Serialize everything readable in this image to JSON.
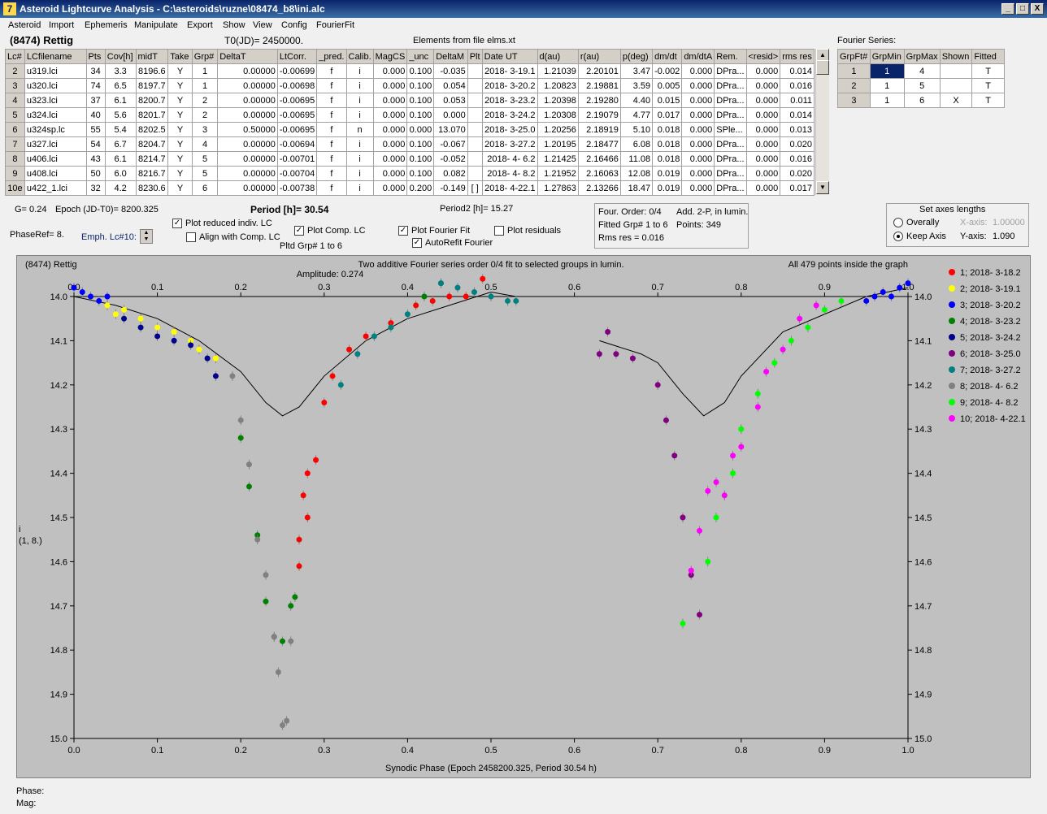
{
  "window": {
    "title": "Asteroid Lightcurve Analysis - C:\\asteroids\\ruzne\\08474_b8\\ini.alc",
    "icon": "app-icon",
    "btn_min": "_",
    "btn_max": "□",
    "btn_close": "X"
  },
  "menu": [
    "Asteroid",
    "Import",
    "Ephemeris",
    "Manipulate",
    "Export",
    "Show",
    "View",
    "Config",
    "FourierFit"
  ],
  "header": {
    "asteroid": "(8474) Rettig",
    "t0": "T0(JD)= 2450000.",
    "elements": "Elements from file elms.xt"
  },
  "table": {
    "columns": [
      "Lc#",
      "LCfilename",
      "Pts",
      "Cov[h]",
      "midT",
      "Take",
      "Grp#",
      "DeltaT",
      "LtCorr.",
      "_pred.",
      "Calib.",
      "MagCS",
      "_unc",
      "DeltaM",
      "Plt",
      "Date UT",
      "d(au)",
      "r(au)",
      "p(deg)",
      "dm/dt",
      "dm/dtA",
      "Rem.",
      "<resid>",
      "rms res"
    ],
    "rows": [
      [
        "2",
        "u319.lci",
        "34",
        "3.3",
        "8196.6",
        "Y",
        "1",
        "0.00000",
        "-0.00699",
        "f",
        "i",
        "0.000",
        "0.100",
        "-0.035",
        "",
        "2018- 3-19.1",
        "1.21039",
        "2.20101",
        "3.47",
        "-0.002",
        "0.000",
        "DPra...",
        "0.000",
        "0.014"
      ],
      [
        "3",
        "u320.lci",
        "74",
        "6.5",
        "8197.7",
        "Y",
        "1",
        "0.00000",
        "-0.00698",
        "f",
        "i",
        "0.000",
        "0.100",
        "0.054",
        "",
        "2018- 3-20.2",
        "1.20823",
        "2.19881",
        "3.59",
        "0.005",
        "0.000",
        "DPra...",
        "0.000",
        "0.016"
      ],
      [
        "4",
        "u323.lci",
        "37",
        "6.1",
        "8200.7",
        "Y",
        "2",
        "0.00000",
        "-0.00695",
        "f",
        "i",
        "0.000",
        "0.100",
        "0.053",
        "",
        "2018- 3-23.2",
        "1.20398",
        "2.19280",
        "4.40",
        "0.015",
        "0.000",
        "DPra...",
        "0.000",
        "0.011"
      ],
      [
        "5",
        "u324.lci",
        "40",
        "5.6",
        "8201.7",
        "Y",
        "2",
        "0.00000",
        "-0.00695",
        "f",
        "i",
        "0.000",
        "0.100",
        "0.000",
        "",
        "2018- 3-24.2",
        "1.20308",
        "2.19079",
        "4.77",
        "0.017",
        "0.000",
        "DPra...",
        "0.000",
        "0.014"
      ],
      [
        "6",
        "u324sp.lc",
        "55",
        "5.4",
        "8202.5",
        "Y",
        "3",
        "0.50000",
        "-0.00695",
        "f",
        "n",
        "0.000",
        "0.000",
        "13.070",
        "",
        "2018- 3-25.0",
        "1.20256",
        "2.18919",
        "5.10",
        "0.018",
        "0.000",
        "SPle...",
        "0.000",
        "0.013"
      ],
      [
        "7",
        "u327.lci",
        "54",
        "6.7",
        "8204.7",
        "Y",
        "4",
        "0.00000",
        "-0.00694",
        "f",
        "i",
        "0.000",
        "0.100",
        "-0.067",
        "",
        "2018- 3-27.2",
        "1.20195",
        "2.18477",
        "6.08",
        "0.018",
        "0.000",
        "DPra...",
        "0.000",
        "0.020"
      ],
      [
        "8",
        "u406.lci",
        "43",
        "6.1",
        "8214.7",
        "Y",
        "5",
        "0.00000",
        "-0.00701",
        "f",
        "i",
        "0.000",
        "0.100",
        "-0.052",
        "",
        "2018- 4- 6.2",
        "1.21425",
        "2.16466",
        "11.08",
        "0.018",
        "0.000",
        "DPra...",
        "0.000",
        "0.016"
      ],
      [
        "9",
        "u408.lci",
        "50",
        "6.0",
        "8216.7",
        "Y",
        "5",
        "0.00000",
        "-0.00704",
        "f",
        "i",
        "0.000",
        "0.100",
        "0.082",
        "",
        "2018- 4- 8.2",
        "1.21952",
        "2.16063",
        "12.08",
        "0.019",
        "0.000",
        "DPra...",
        "0.000",
        "0.020"
      ],
      [
        "10e",
        "u422_1.lci",
        "32",
        "4.2",
        "8230.6",
        "Y",
        "6",
        "0.00000",
        "-0.00738",
        "f",
        "i",
        "0.000",
        "0.200",
        "-0.149",
        "[ ]",
        "2018- 4-22.1",
        "1.27863",
        "2.13266",
        "18.47",
        "0.019",
        "0.000",
        "DPra...",
        "0.000",
        "0.017"
      ]
    ]
  },
  "fourier": {
    "label": "Fourier Series:",
    "columns": [
      "GrpFt#",
      "GrpMin",
      "GrpMax",
      "Shown",
      "Fitted"
    ],
    "rows": [
      [
        "1",
        "1",
        "4",
        "",
        "T"
      ],
      [
        "2",
        "1",
        "5",
        "",
        "T"
      ],
      [
        "3",
        "1",
        "6",
        "X",
        "T"
      ]
    ]
  },
  "controls": {
    "g": "G= 0.24",
    "epoch": "Epoch (JD-T0)= 8200.325",
    "period": "Period [h]= 30.54",
    "period2": "Period2 [h]= 15.27",
    "phaseref": "PhaseRef= 8.",
    "emph": "Emph. Lc#10:",
    "plot_reduced": "Plot reduced indiv. LC",
    "align": "Align with Comp. LC",
    "plot_comp": "Plot Comp. LC",
    "pltd_grp": "Pltd Grp#  1   to   6",
    "plot_fourier": "Plot Fourier Fit",
    "autorefit": "AutoRefit Fourier",
    "plot_resid": "Plot residuals",
    "four_order": "Four. Order:  0/4",
    "add2p": "Add. 2-P, in lumin.",
    "fitted": "Fitted Grp# 1 to 6",
    "points": "Points: 349",
    "rms": "Rms res      = 0.016",
    "axes_title": "Set axes lengths",
    "overally": "Overally",
    "keepaxis": "Keep Axis",
    "xaxis_label": "X-axis:",
    "xaxis_val": "1.00000",
    "yaxis_label": "Y-axis:",
    "yaxis_val": "1.090"
  },
  "status": {
    "phase": "Phase:",
    "mag": "Mag:"
  },
  "chart_data": {
    "type": "scatter",
    "title": "Two additive Fourier series order 0/4 fit to selected groups in lumin.",
    "subtitle": "Amplitude: 0.274",
    "corner_left": "(8474) Rettig",
    "corner_right": "All 479 points inside the graph",
    "xlabel": "Synodic Phase (Epoch 2458200.325, Period 30.54 h)",
    "ylabel": "i",
    "ylabel2": "(1, 8.)",
    "xlim": [
      0.0,
      1.0
    ],
    "ylim": [
      15.0,
      14.0
    ],
    "x_ticks": [
      "0.0",
      "0.1",
      "0.2",
      "0.3",
      "0.4",
      "0.5",
      "0.6",
      "0.7",
      "0.8",
      "0.9",
      "1.0"
    ],
    "y_ticks": [
      "14.0",
      "14.1",
      "14.2",
      "14.3",
      "14.4",
      "14.5",
      "14.6",
      "14.7",
      "14.8",
      "14.9",
      "15.0"
    ],
    "fit": [
      [
        0.0,
        14.0
      ],
      [
        0.05,
        14.02
      ],
      [
        0.1,
        14.05
      ],
      [
        0.15,
        14.1
      ],
      [
        0.2,
        14.17
      ],
      [
        0.23,
        14.24
      ],
      [
        0.25,
        14.27
      ],
      [
        0.27,
        14.25
      ],
      [
        0.3,
        14.18
      ],
      [
        0.35,
        14.1
      ],
      [
        0.4,
        14.05
      ],
      [
        0.45,
        14.02
      ],
      [
        0.5,
        13.99
      ],
      [
        0.53,
        14.0
      ],
      [
        0.63,
        14.1
      ],
      [
        0.68,
        14.13
      ],
      [
        0.7,
        14.15
      ],
      [
        0.73,
        14.22
      ],
      [
        0.755,
        14.27
      ],
      [
        0.78,
        14.24
      ],
      [
        0.8,
        14.18
      ],
      [
        0.85,
        14.08
      ],
      [
        0.9,
        14.04
      ],
      [
        0.95,
        14.0
      ],
      [
        1.0,
        13.98
      ]
    ],
    "series": [
      {
        "name": "1; 2018- 3-18.2",
        "color": "#ff0000",
        "x": [
          0.27,
          0.28,
          0.29,
          0.3,
          0.31,
          0.33,
          0.35,
          0.38,
          0.41,
          0.43,
          0.45,
          0.47,
          0.49,
          0.27,
          0.275,
          0.28
        ],
        "y": [
          14.61,
          14.5,
          14.37,
          14.24,
          14.18,
          14.12,
          14.09,
          14.06,
          14.02,
          14.01,
          14.0,
          14.0,
          13.96,
          14.55,
          14.45,
          14.4
        ]
      },
      {
        "name": "2; 2018- 3-19.1",
        "color": "#ffff00",
        "x": [
          0.04,
          0.05,
          0.06,
          0.08,
          0.1,
          0.12,
          0.14,
          0.15,
          0.17
        ],
        "y": [
          14.02,
          14.04,
          14.03,
          14.05,
          14.07,
          14.08,
          14.1,
          14.12,
          14.14
        ]
      },
      {
        "name": "3; 2018- 3-20.2",
        "color": "#0000ff",
        "x": [
          0.0,
          0.01,
          0.02,
          0.03,
          0.04,
          0.97,
          0.98,
          0.99,
          1.0,
          0.95,
          0.96
        ],
        "y": [
          13.98,
          13.99,
          14.0,
          14.01,
          14.0,
          13.99,
          14.0,
          13.98,
          13.97,
          14.01,
          14.0
        ]
      },
      {
        "name": "4; 2018- 3-23.2",
        "color": "#008000",
        "x": [
          0.2,
          0.21,
          0.22,
          0.23,
          0.24,
          0.25,
          0.26,
          0.265,
          0.42,
          0.44
        ],
        "y": [
          14.32,
          14.43,
          14.54,
          14.69,
          14.77,
          14.78,
          14.7,
          14.68,
          14.0,
          13.97
        ]
      },
      {
        "name": "5; 2018- 3-24.2",
        "color": "#00008b",
        "x": [
          0.06,
          0.08,
          0.1,
          0.12,
          0.14,
          0.16,
          0.17
        ],
        "y": [
          14.05,
          14.07,
          14.09,
          14.1,
          14.11,
          14.14,
          14.18
        ]
      },
      {
        "name": "6; 2018- 3-25.0",
        "color": "#800080",
        "x": [
          0.63,
          0.64,
          0.65,
          0.67,
          0.7,
          0.71,
          0.72,
          0.73,
          0.74,
          0.75
        ],
        "y": [
          14.13,
          14.08,
          14.13,
          14.14,
          14.2,
          14.28,
          14.36,
          14.5,
          14.63,
          14.72
        ]
      },
      {
        "name": "7; 2018- 3-27.2",
        "color": "#008080",
        "x": [
          0.32,
          0.34,
          0.36,
          0.38,
          0.4,
          0.44,
          0.46,
          0.48,
          0.5,
          0.52,
          0.53
        ],
        "y": [
          14.2,
          14.13,
          14.09,
          14.07,
          14.04,
          13.97,
          13.98,
          13.99,
          14.0,
          14.01,
          14.01
        ]
      },
      {
        "name": "8; 2018- 4- 6.2",
        "color": "#808080",
        "x": [
          0.19,
          0.2,
          0.21,
          0.22,
          0.23,
          0.24,
          0.245,
          0.25,
          0.255,
          0.26
        ],
        "y": [
          14.18,
          14.28,
          14.38,
          14.55,
          14.63,
          14.77,
          14.85,
          14.97,
          14.96,
          14.78
        ]
      },
      {
        "name": "9; 2018- 4- 8.2",
        "color": "#00ff00",
        "x": [
          0.73,
          0.76,
          0.77,
          0.78,
          0.79,
          0.8,
          0.82,
          0.84,
          0.86,
          0.88,
          0.9,
          0.92
        ],
        "y": [
          14.74,
          14.6,
          14.5,
          14.45,
          14.4,
          14.3,
          14.22,
          14.15,
          14.1,
          14.07,
          14.03,
          14.01
        ]
      },
      {
        "name": "10; 2018- 4-22.1",
        "color": "#ff00ff",
        "x": [
          0.74,
          0.75,
          0.76,
          0.77,
          0.78,
          0.79,
          0.8,
          0.82,
          0.83,
          0.85,
          0.87,
          0.89
        ],
        "y": [
          14.62,
          14.53,
          14.44,
          14.42,
          14.45,
          14.36,
          14.34,
          14.25,
          14.17,
          14.12,
          14.05,
          14.02
        ]
      }
    ]
  }
}
